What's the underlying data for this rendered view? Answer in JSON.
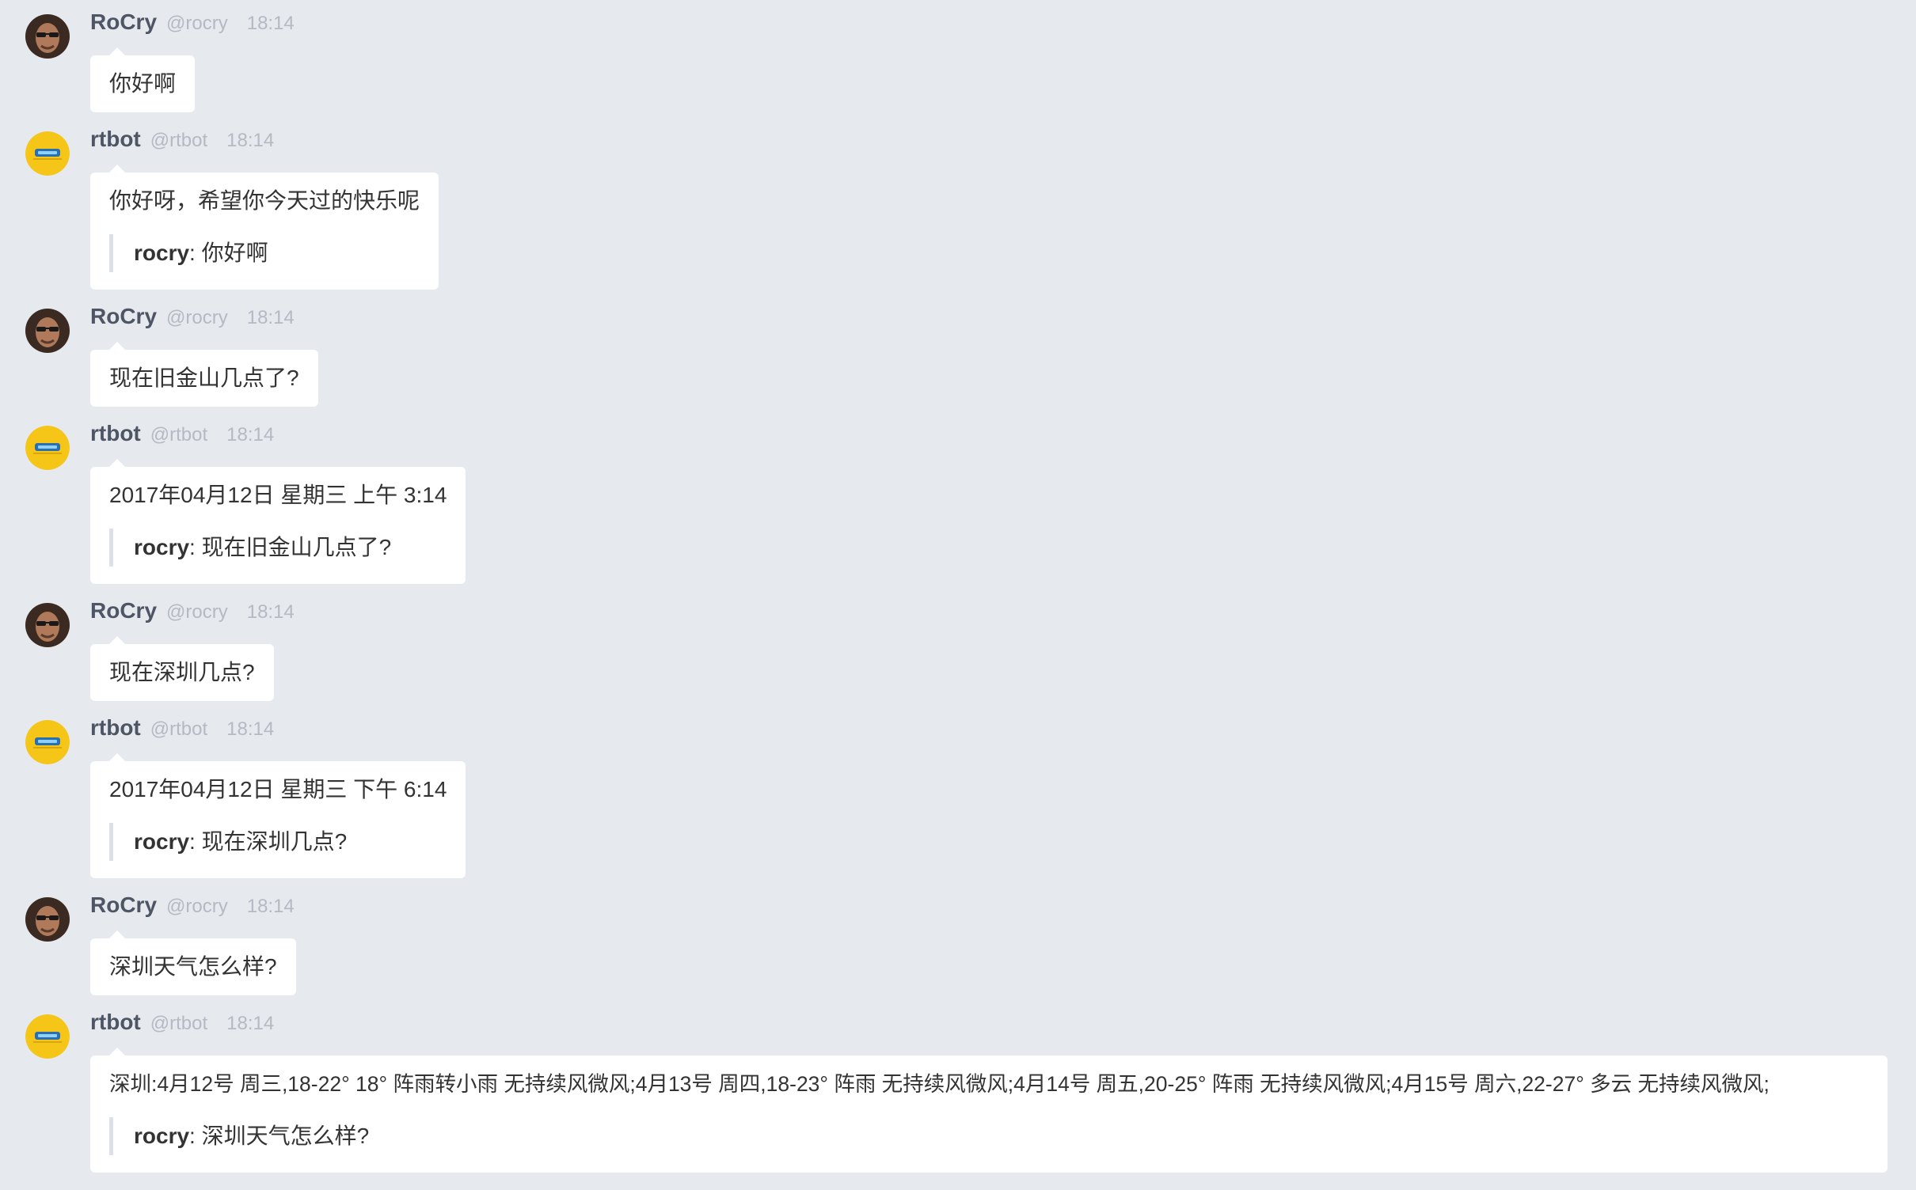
{
  "colors": {
    "background": "#e6e9ed",
    "bubble": "#ffffff",
    "name": "#4e5665",
    "meta": "#b5b9c3",
    "quote_bar": "#dde0e6",
    "bot_avatar": "#f5c518"
  },
  "messages": [
    {
      "name": "RoCry",
      "handle": "@rocry",
      "time": "18:14",
      "avatar_icon": "user-avatar-icon",
      "text": "你好啊"
    },
    {
      "name": "rtbot",
      "handle": "@rtbot",
      "time": "18:14",
      "avatar_icon": "bot-avatar-icon",
      "text": "你好呀，希望你今天过的快乐呢",
      "quote": {
        "user": "rocry",
        "separator": ": ",
        "text": "你好啊"
      }
    },
    {
      "name": "RoCry",
      "handle": "@rocry",
      "time": "18:14",
      "avatar_icon": "user-avatar-icon",
      "text": "现在旧金山几点了?"
    },
    {
      "name": "rtbot",
      "handle": "@rtbot",
      "time": "18:14",
      "avatar_icon": "bot-avatar-icon",
      "text": "2017年04月12日 星期三 上午 3:14",
      "quote": {
        "user": "rocry",
        "separator": ": ",
        "text": "现在旧金山几点了?"
      }
    },
    {
      "name": "RoCry",
      "handle": "@rocry",
      "time": "18:14",
      "avatar_icon": "user-avatar-icon",
      "text": "现在深圳几点?"
    },
    {
      "name": "rtbot",
      "handle": "@rtbot",
      "time": "18:14",
      "avatar_icon": "bot-avatar-icon",
      "text": "2017年04月12日 星期三 下午 6:14",
      "quote": {
        "user": "rocry",
        "separator": ": ",
        "text": "现在深圳几点?"
      }
    },
    {
      "name": "RoCry",
      "handle": "@rocry",
      "time": "18:14",
      "avatar_icon": "user-avatar-icon",
      "text": "深圳天气怎么样?"
    },
    {
      "name": "rtbot",
      "handle": "@rtbot",
      "time": "18:14",
      "avatar_icon": "bot-avatar-icon",
      "text": "深圳:4月12号 周三,18-22° 18° 阵雨转小雨 无持续风微风;4月13号 周四,18-23° 阵雨 无持续风微风;4月14号 周五,20-25° 阵雨 无持续风微风;4月15号 周六,22-27° 多云 无持续风微风;",
      "quote": {
        "user": "rocry",
        "separator": ": ",
        "text": "深圳天气怎么样?"
      }
    }
  ]
}
